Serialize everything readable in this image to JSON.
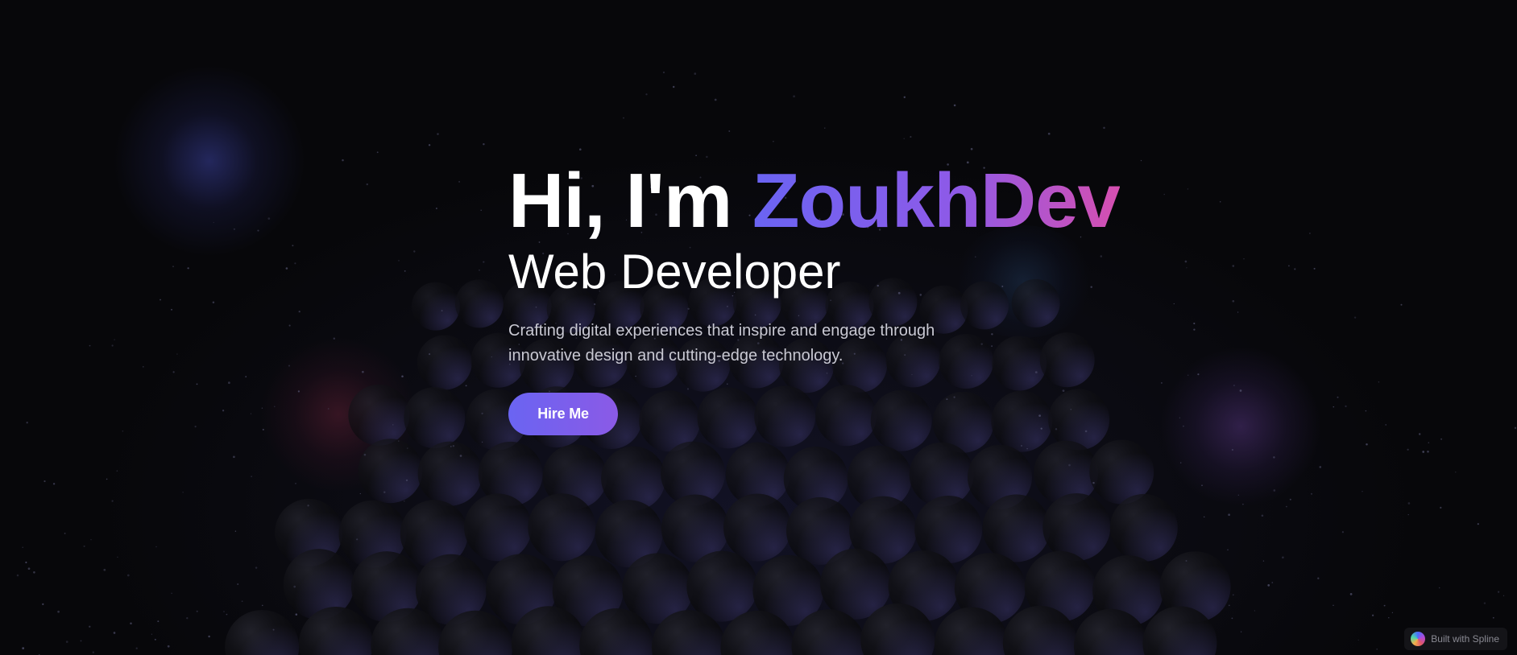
{
  "hero": {
    "greeting": "Hi, I'm ",
    "name": "ZoukhDev",
    "role": "Web Developer",
    "tagline": "Crafting digital experiences that inspire and engage through innovative design and cutting-edge technology.",
    "cta_label": "Hire Me"
  },
  "badge": {
    "label": "Built with Spline",
    "icon": "spline-logo-icon"
  },
  "colors": {
    "background": "#07070a",
    "accent_start": "#6a64f2",
    "accent_mid": "#8e5ae8",
    "accent_end": "#d64fb0",
    "text_primary": "#ffffff",
    "text_secondary": "#c9c9d3"
  }
}
